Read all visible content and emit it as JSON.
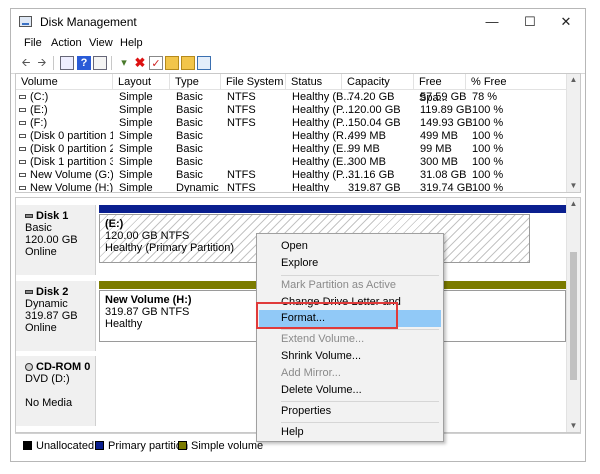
{
  "window": {
    "title": "Disk Management"
  },
  "menu": [
    "File",
    "Action",
    "View",
    "Help"
  ],
  "toolbar": {
    "buttons": [
      "back-arrow-icon",
      "forward-arrow-icon",
      "console-tree-icon",
      "help-icon",
      "properties-icon",
      "connect-icon",
      "delete-icon",
      "check-icon",
      "folder-icon",
      "search-icon",
      "refresh-icon"
    ]
  },
  "volume_list": {
    "columns": [
      "Volume",
      "Layout",
      "Type",
      "File System",
      "Status",
      "Capacity",
      "Free Spa...",
      "% Free"
    ],
    "rows": [
      [
        "(C:)",
        "Simple",
        "Basic",
        "NTFS",
        "Healthy (B...",
        "74.20 GB",
        "57.59 GB",
        "78 %"
      ],
      [
        "(E:)",
        "Simple",
        "Basic",
        "NTFS",
        "Healthy (P...",
        "120.00 GB",
        "119.89 GB",
        "100 %"
      ],
      [
        "(F:)",
        "Simple",
        "Basic",
        "NTFS",
        "Healthy (P...",
        "150.04 GB",
        "149.93 GB",
        "100 %"
      ],
      [
        "(Disk 0 partition 1)",
        "Simple",
        "Basic",
        "",
        "Healthy (R...",
        "499 MB",
        "499 MB",
        "100 %"
      ],
      [
        "(Disk 0 partition 2)",
        "Simple",
        "Basic",
        "",
        "Healthy (E...",
        "99 MB",
        "99 MB",
        "100 %"
      ],
      [
        "(Disk 1 partition 3)",
        "Simple",
        "Basic",
        "",
        "Healthy (E...",
        "300 MB",
        "300 MB",
        "100 %"
      ],
      [
        "New Volume (G:)",
        "Simple",
        "Basic",
        "NTFS",
        "Healthy (P...",
        "31.16 GB",
        "31.08 GB",
        "100 %"
      ],
      [
        "New Volume (H:)",
        "Simple",
        "Dynamic",
        "NTFS",
        "Healthy",
        "319.87 GB",
        "319.74 GB",
        "100 %"
      ]
    ]
  },
  "disks": [
    {
      "name": "Disk 1",
      "type": "Basic",
      "size": "120.00 GB",
      "status": "Online",
      "partition": {
        "label": "(E:)",
        "size": "120.00 GB NTFS",
        "status": "Healthy (Primary Partition)"
      }
    },
    {
      "name": "Disk 2",
      "type": "Dynamic",
      "size": "319.87 GB",
      "status": "Online",
      "partition": {
        "label": "New Volume  (H:)",
        "size": "319.87 GB NTFS",
        "status": "Healthy"
      }
    },
    {
      "name": "CD-ROM 0",
      "type": "DVD (D:)",
      "status": "No Media"
    }
  ],
  "legend": [
    {
      "label": "Unallocated",
      "color": "#000000"
    },
    {
      "label": "Primary partition",
      "color": "#0a1f8f"
    },
    {
      "label": "Simple volume",
      "color": "#7b7b00"
    }
  ],
  "context_menu": {
    "items": [
      {
        "label": "Open",
        "enabled": true
      },
      {
        "label": "Explore",
        "enabled": true
      },
      {
        "label": "Mark Partition as Active",
        "enabled": false
      },
      {
        "label": "Change Drive Letter and Paths...",
        "enabled": true
      },
      {
        "label": "Format...",
        "enabled": true,
        "highlighted": true
      },
      {
        "label": "Extend Volume...",
        "enabled": false
      },
      {
        "label": "Shrink Volume...",
        "enabled": true
      },
      {
        "label": "Add Mirror...",
        "enabled": false
      },
      {
        "label": "Delete Volume...",
        "enabled": true
      },
      {
        "label": "Properties",
        "enabled": true
      },
      {
        "label": "Help",
        "enabled": true
      }
    ]
  },
  "colors": {
    "primary_partition": "#0a1f8f",
    "simple_volume": "#7b7b00",
    "highlight": "#91c9f7",
    "annotation": "#e03a3a"
  }
}
